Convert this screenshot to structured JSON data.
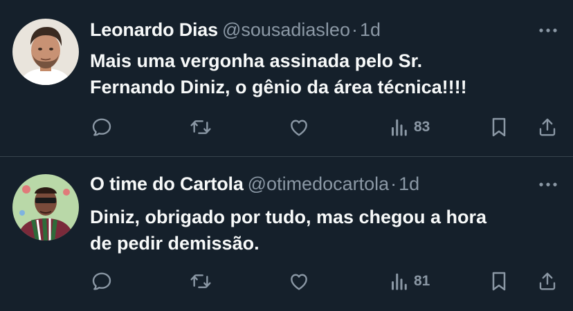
{
  "theme": {
    "background": "#15202b",
    "primary_text": "#f7f9f9",
    "secondary_text": "#8b98a5",
    "divider": "#38444d"
  },
  "tweets": [
    {
      "display_name": "Leonardo Dias",
      "handle": "@sousadiasleo",
      "separator": "·",
      "time": "1d",
      "text_lines": [
        "Mais uma vergonha assinada pelo Sr.",
        "Fernando Diniz, o gênio da área técnica!!!!"
      ],
      "avatar": "profile-photo",
      "actions": {
        "reply_icon": "comment-bubble-icon",
        "retweet_icon": "retweet-arrows-icon",
        "like_icon": "heart-icon",
        "views_icon": "bar-chart-icon",
        "views": "83",
        "bookmark_icon": "bookmark-icon",
        "share_icon": "share-upload-icon"
      }
    },
    {
      "display_name": "O time do Cartola",
      "handle": "@otimedocartola",
      "separator": "·",
      "time": "1d",
      "text_lines": [
        "Diniz, obrigado por tudo, mas chegou a hora",
        "de pedir demissão."
      ],
      "avatar": "profile-illustration",
      "actions": {
        "reply_icon": "comment-bubble-icon",
        "retweet_icon": "retweet-arrows-icon",
        "like_icon": "heart-icon",
        "views_icon": "bar-chart-icon",
        "views": "81",
        "bookmark_icon": "bookmark-icon",
        "share_icon": "share-upload-icon"
      }
    }
  ]
}
